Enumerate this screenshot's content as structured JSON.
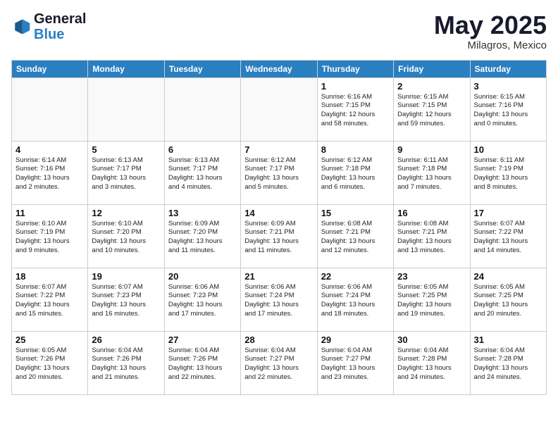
{
  "logo": {
    "line1": "General",
    "line2": "Blue"
  },
  "title": "May 2025",
  "location": "Milagros, Mexico",
  "weekdays": [
    "Sunday",
    "Monday",
    "Tuesday",
    "Wednesday",
    "Thursday",
    "Friday",
    "Saturday"
  ],
  "weeks": [
    [
      {
        "day": "",
        "text": ""
      },
      {
        "day": "",
        "text": ""
      },
      {
        "day": "",
        "text": ""
      },
      {
        "day": "",
        "text": ""
      },
      {
        "day": "1",
        "text": "Sunrise: 6:16 AM\nSunset: 7:15 PM\nDaylight: 12 hours\nand 58 minutes."
      },
      {
        "day": "2",
        "text": "Sunrise: 6:15 AM\nSunset: 7:15 PM\nDaylight: 12 hours\nand 59 minutes."
      },
      {
        "day": "3",
        "text": "Sunrise: 6:15 AM\nSunset: 7:16 PM\nDaylight: 13 hours\nand 0 minutes."
      }
    ],
    [
      {
        "day": "4",
        "text": "Sunrise: 6:14 AM\nSunset: 7:16 PM\nDaylight: 13 hours\nand 2 minutes."
      },
      {
        "day": "5",
        "text": "Sunrise: 6:13 AM\nSunset: 7:17 PM\nDaylight: 13 hours\nand 3 minutes."
      },
      {
        "day": "6",
        "text": "Sunrise: 6:13 AM\nSunset: 7:17 PM\nDaylight: 13 hours\nand 4 minutes."
      },
      {
        "day": "7",
        "text": "Sunrise: 6:12 AM\nSunset: 7:17 PM\nDaylight: 13 hours\nand 5 minutes."
      },
      {
        "day": "8",
        "text": "Sunrise: 6:12 AM\nSunset: 7:18 PM\nDaylight: 13 hours\nand 6 minutes."
      },
      {
        "day": "9",
        "text": "Sunrise: 6:11 AM\nSunset: 7:18 PM\nDaylight: 13 hours\nand 7 minutes."
      },
      {
        "day": "10",
        "text": "Sunrise: 6:11 AM\nSunset: 7:19 PM\nDaylight: 13 hours\nand 8 minutes."
      }
    ],
    [
      {
        "day": "11",
        "text": "Sunrise: 6:10 AM\nSunset: 7:19 PM\nDaylight: 13 hours\nand 9 minutes."
      },
      {
        "day": "12",
        "text": "Sunrise: 6:10 AM\nSunset: 7:20 PM\nDaylight: 13 hours\nand 10 minutes."
      },
      {
        "day": "13",
        "text": "Sunrise: 6:09 AM\nSunset: 7:20 PM\nDaylight: 13 hours\nand 11 minutes."
      },
      {
        "day": "14",
        "text": "Sunrise: 6:09 AM\nSunset: 7:21 PM\nDaylight: 13 hours\nand 11 minutes."
      },
      {
        "day": "15",
        "text": "Sunrise: 6:08 AM\nSunset: 7:21 PM\nDaylight: 13 hours\nand 12 minutes."
      },
      {
        "day": "16",
        "text": "Sunrise: 6:08 AM\nSunset: 7:21 PM\nDaylight: 13 hours\nand 13 minutes."
      },
      {
        "day": "17",
        "text": "Sunrise: 6:07 AM\nSunset: 7:22 PM\nDaylight: 13 hours\nand 14 minutes."
      }
    ],
    [
      {
        "day": "18",
        "text": "Sunrise: 6:07 AM\nSunset: 7:22 PM\nDaylight: 13 hours\nand 15 minutes."
      },
      {
        "day": "19",
        "text": "Sunrise: 6:07 AM\nSunset: 7:23 PM\nDaylight: 13 hours\nand 16 minutes."
      },
      {
        "day": "20",
        "text": "Sunrise: 6:06 AM\nSunset: 7:23 PM\nDaylight: 13 hours\nand 17 minutes."
      },
      {
        "day": "21",
        "text": "Sunrise: 6:06 AM\nSunset: 7:24 PM\nDaylight: 13 hours\nand 17 minutes."
      },
      {
        "day": "22",
        "text": "Sunrise: 6:06 AM\nSunset: 7:24 PM\nDaylight: 13 hours\nand 18 minutes."
      },
      {
        "day": "23",
        "text": "Sunrise: 6:05 AM\nSunset: 7:25 PM\nDaylight: 13 hours\nand 19 minutes."
      },
      {
        "day": "24",
        "text": "Sunrise: 6:05 AM\nSunset: 7:25 PM\nDaylight: 13 hours\nand 20 minutes."
      }
    ],
    [
      {
        "day": "25",
        "text": "Sunrise: 6:05 AM\nSunset: 7:26 PM\nDaylight: 13 hours\nand 20 minutes."
      },
      {
        "day": "26",
        "text": "Sunrise: 6:04 AM\nSunset: 7:26 PM\nDaylight: 13 hours\nand 21 minutes."
      },
      {
        "day": "27",
        "text": "Sunrise: 6:04 AM\nSunset: 7:26 PM\nDaylight: 13 hours\nand 22 minutes."
      },
      {
        "day": "28",
        "text": "Sunrise: 6:04 AM\nSunset: 7:27 PM\nDaylight: 13 hours\nand 22 minutes."
      },
      {
        "day": "29",
        "text": "Sunrise: 6:04 AM\nSunset: 7:27 PM\nDaylight: 13 hours\nand 23 minutes."
      },
      {
        "day": "30",
        "text": "Sunrise: 6:04 AM\nSunset: 7:28 PM\nDaylight: 13 hours\nand 24 minutes."
      },
      {
        "day": "31",
        "text": "Sunrise: 6:04 AM\nSunset: 7:28 PM\nDaylight: 13 hours\nand 24 minutes."
      }
    ]
  ]
}
